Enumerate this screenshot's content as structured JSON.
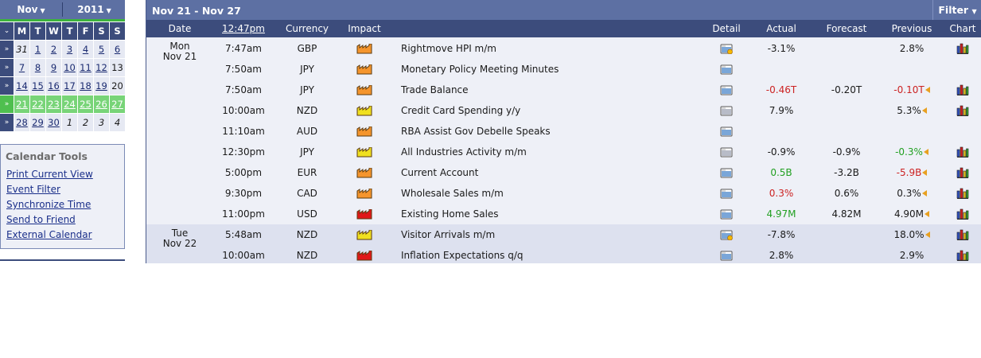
{
  "mini_calendar": {
    "month": "Nov",
    "year": "2011",
    "dow": [
      "M",
      "T",
      "W",
      "T",
      "F",
      "S",
      "S"
    ],
    "side_glyph": "»",
    "weeks": [
      [
        "31",
        "1",
        "2",
        "3",
        "4",
        "5",
        "6"
      ],
      [
        "7",
        "8",
        "9",
        "10",
        "11",
        "12",
        "13"
      ],
      [
        "14",
        "15",
        "16",
        "17",
        "18",
        "19",
        "20"
      ],
      [
        "21",
        "22",
        "23",
        "24",
        "25",
        "26",
        "27"
      ],
      [
        "28",
        "29",
        "30",
        "1",
        "2",
        "3",
        "4"
      ]
    ]
  },
  "calendar_tools": {
    "title": "Calendar Tools",
    "links": [
      "Print Current View",
      "Event Filter",
      "Synchronize Time",
      "Send to Friend",
      "External Calendar"
    ]
  },
  "panel": {
    "range": "Nov 21 - Nov 27",
    "filter": "Filter",
    "headers": {
      "date": "Date",
      "time": "12:47pm",
      "currency": "Currency",
      "impact": "Impact",
      "detail": "Detail",
      "actual": "Actual",
      "forecast": "Forecast",
      "previous": "Previous",
      "chart": "Chart"
    }
  },
  "days": [
    {
      "weekday": "Mon",
      "date": "Nov 21"
    },
    {
      "weekday": "Tue",
      "date": "Nov 22"
    }
  ],
  "colors": {
    "impact_high": "#e01818",
    "impact_med": "#f5952d",
    "impact_low": "#f0e020",
    "accent": "#5d70a3"
  },
  "events": [
    {
      "time": "7:47am",
      "currency": "GBP",
      "impact": "medium",
      "event": "Rightmove HPI m/m",
      "detail_icon": "detail-star-icon",
      "actual": "-3.1%",
      "actual_color": "",
      "forecast": "",
      "previous": "2.8%",
      "previous_color": "",
      "revised": false,
      "chart": true
    },
    {
      "time": "7:50am",
      "currency": "JPY",
      "impact": "medium",
      "event": "Monetary Policy Meeting Minutes",
      "detail_icon": "detail-icon",
      "actual": "",
      "actual_color": "",
      "forecast": "",
      "previous": "",
      "previous_color": "",
      "revised": false,
      "chart": false
    },
    {
      "time": "7:50am",
      "currency": "JPY",
      "impact": "medium",
      "event": "Trade Balance",
      "detail_icon": "detail-icon",
      "actual": "-0.46T",
      "actual_color": "red",
      "forecast": "-0.20T",
      "previous": "-0.10T",
      "previous_color": "red",
      "revised": true,
      "chart": true
    },
    {
      "time": "10:00am",
      "currency": "NZD",
      "impact": "low",
      "event": "Credit Card Spending y/y",
      "detail_icon": "detail-gray-icon",
      "actual": "7.9%",
      "actual_color": "",
      "forecast": "",
      "previous": "5.3%",
      "previous_color": "",
      "revised": true,
      "chart": true
    },
    {
      "time": "11:10am",
      "currency": "AUD",
      "impact": "medium",
      "event": "RBA Assist Gov Debelle Speaks",
      "detail_icon": "detail-icon",
      "actual": "",
      "actual_color": "",
      "forecast": "",
      "previous": "",
      "previous_color": "",
      "revised": false,
      "chart": false
    },
    {
      "time": "12:30pm",
      "currency": "JPY",
      "impact": "low",
      "event": "All Industries Activity m/m",
      "detail_icon": "detail-gray-icon",
      "actual": "-0.9%",
      "actual_color": "",
      "forecast": "-0.9%",
      "previous": "-0.3%",
      "previous_color": "green",
      "revised": true,
      "chart": true
    },
    {
      "time": "5:00pm",
      "currency": "EUR",
      "impact": "medium",
      "event": "Current Account",
      "detail_icon": "detail-icon",
      "actual": "0.5B",
      "actual_color": "green",
      "forecast": "-3.2B",
      "previous": "-5.9B",
      "previous_color": "red",
      "revised": true,
      "chart": true
    },
    {
      "time": "9:30pm",
      "currency": "CAD",
      "impact": "medium",
      "event": "Wholesale Sales m/m",
      "detail_icon": "detail-icon",
      "actual": "0.3%",
      "actual_color": "red",
      "forecast": "0.6%",
      "previous": "0.3%",
      "previous_color": "",
      "revised": true,
      "chart": true
    },
    {
      "time": "11:00pm",
      "currency": "USD",
      "impact": "high",
      "event": "Existing Home Sales",
      "detail_icon": "detail-icon",
      "actual": "4.97M",
      "actual_color": "green",
      "forecast": "4.82M",
      "previous": "4.90M",
      "previous_color": "",
      "revised": true,
      "chart": true
    },
    {
      "time": "5:48am",
      "currency": "NZD",
      "impact": "low",
      "event": "Visitor Arrivals m/m",
      "detail_icon": "detail-star-icon",
      "actual": "-7.8%",
      "actual_color": "",
      "forecast": "",
      "previous": "18.0%",
      "previous_color": "",
      "revised": true,
      "chart": true
    },
    {
      "time": "10:00am",
      "currency": "NZD",
      "impact": "high",
      "event": "Inflation Expectations q/q",
      "detail_icon": "detail-icon",
      "actual": "2.8%",
      "actual_color": "",
      "forecast": "",
      "previous": "2.9%",
      "previous_color": "",
      "revised": false,
      "chart": true
    }
  ]
}
